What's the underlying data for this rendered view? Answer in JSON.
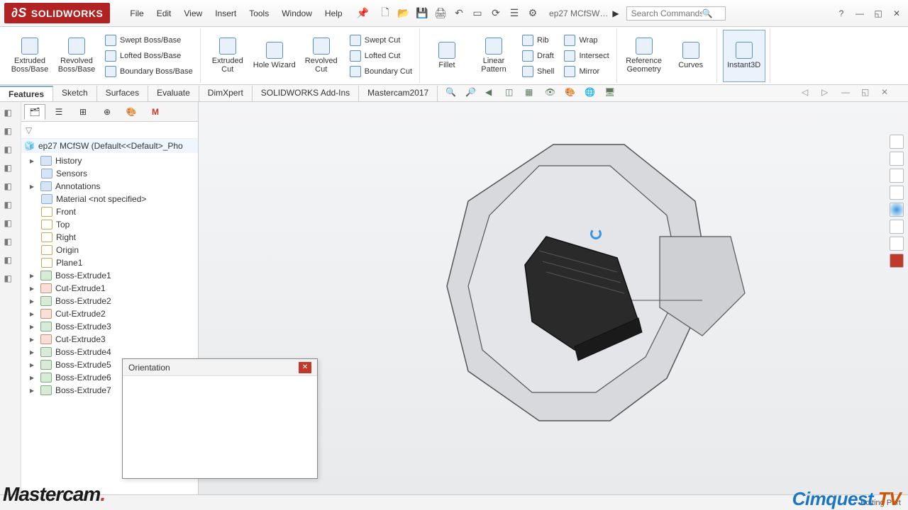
{
  "app": {
    "name": "SOLIDWORKS",
    "doc": "ep27 MCfSW…"
  },
  "menu": [
    "File",
    "Edit",
    "View",
    "Insert",
    "Tools",
    "Window",
    "Help"
  ],
  "search": {
    "placeholder": "Search Commands"
  },
  "ribbon": {
    "groups": [
      {
        "big": [
          {
            "label": "Extruded Boss/Base"
          },
          {
            "label": "Revolved Boss/Base"
          }
        ],
        "col": [
          {
            "label": "Swept Boss/Base"
          },
          {
            "label": "Lofted Boss/Base"
          },
          {
            "label": "Boundary Boss/Base"
          }
        ]
      },
      {
        "big": [
          {
            "label": "Extruded Cut"
          },
          {
            "label": "Hole Wizard"
          },
          {
            "label": "Revolved Cut"
          }
        ],
        "col": [
          {
            "label": "Swept Cut"
          },
          {
            "label": "Lofted Cut"
          },
          {
            "label": "Boundary Cut"
          }
        ]
      },
      {
        "big": [
          {
            "label": "Fillet"
          },
          {
            "label": "Linear Pattern"
          }
        ],
        "col": [
          {
            "label": "Rib"
          },
          {
            "label": "Draft"
          },
          {
            "label": "Shell"
          }
        ],
        "col2": [
          {
            "label": "Wrap"
          },
          {
            "label": "Intersect"
          },
          {
            "label": "Mirror"
          }
        ]
      },
      {
        "big": [
          {
            "label": "Reference Geometry"
          },
          {
            "label": "Curves"
          }
        ]
      },
      {
        "big": [
          {
            "label": "Instant3D",
            "active": true
          }
        ]
      }
    ]
  },
  "tabs": [
    "Features",
    "Sketch",
    "Surfaces",
    "Evaluate",
    "DimXpert",
    "SOLIDWORKS Add-Ins",
    "Mastercam2017"
  ],
  "activeTab": "Features",
  "tree": {
    "root": "ep27 MCfSW  (Default<<Default>_Pho",
    "items": [
      {
        "label": "History",
        "icon": "hist",
        "exp": "▸"
      },
      {
        "label": "Sensors",
        "icon": "hist"
      },
      {
        "label": "Annotations",
        "icon": "hist",
        "exp": "▸"
      },
      {
        "label": "Material <not specified>",
        "icon": "hist"
      },
      {
        "label": "Front",
        "icon": "plane"
      },
      {
        "label": "Top",
        "icon": "plane"
      },
      {
        "label": "Right",
        "icon": "plane"
      },
      {
        "label": "Origin",
        "icon": "plane"
      },
      {
        "label": "Plane1",
        "icon": "plane"
      },
      {
        "label": "Boss-Extrude1",
        "icon": "feat",
        "exp": "▸"
      },
      {
        "label": "Cut-Extrude1",
        "icon": "cut",
        "exp": "▸"
      },
      {
        "label": "Boss-Extrude2",
        "icon": "feat",
        "exp": "▸"
      },
      {
        "label": "Cut-Extrude2",
        "icon": "cut",
        "exp": "▸"
      },
      {
        "label": "Boss-Extrude3",
        "icon": "feat",
        "exp": "▸"
      },
      {
        "label": "Cut-Extrude3",
        "icon": "cut",
        "exp": "▸"
      },
      {
        "label": "Boss-Extrude4",
        "icon": "feat",
        "exp": "▸"
      },
      {
        "label": "Boss-Extrude5",
        "icon": "feat",
        "exp": "▸"
      },
      {
        "label": "Boss-Extrude6",
        "icon": "feat",
        "exp": "▸"
      },
      {
        "label": "Boss-Extrude7",
        "icon": "feat",
        "exp": "▸"
      }
    ]
  },
  "dialog": {
    "title": "Orientation"
  },
  "status": {
    "mode": "Editing Part"
  },
  "logos": {
    "mc": "Mastercam",
    "cq1": "Cimquest",
    "cq2": "TV"
  }
}
